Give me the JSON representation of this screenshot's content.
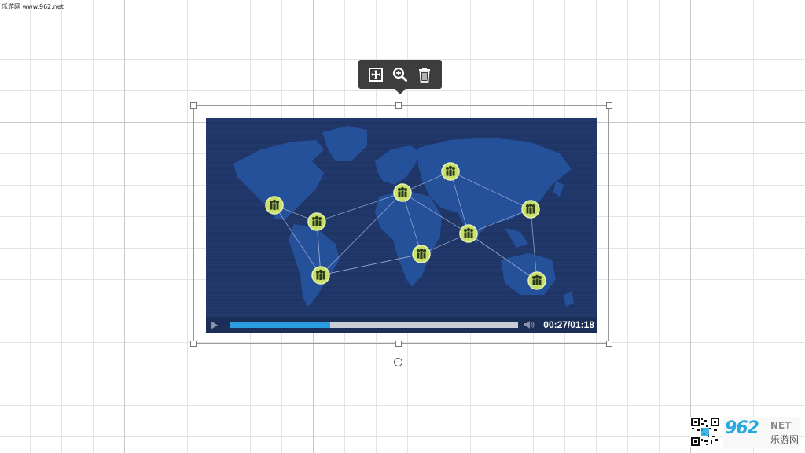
{
  "watermark_top": "乐游网 www.962.net",
  "toolbar": {
    "buttons": [
      {
        "name": "fit-to-frame-icon"
      },
      {
        "name": "zoom-in-icon"
      },
      {
        "name": "trash-icon"
      }
    ]
  },
  "video": {
    "current_time": "00:27",
    "duration": "01:18",
    "time_display": "00:27/01:18",
    "progress": 0.35,
    "colors": {
      "background": "#1e3566",
      "land": "#25509a",
      "node": "#c8e06a",
      "progress": "#2a9ee0"
    }
  },
  "brand": {
    "logo_text": "962",
    "net_text": "NET",
    "cn_text": "乐游网"
  }
}
